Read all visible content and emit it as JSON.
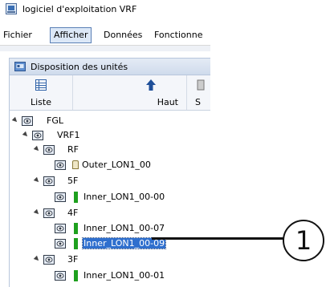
{
  "window": {
    "title": "logiciel d'exploitation VRF"
  },
  "menu": {
    "items": [
      {
        "label": "Fichier"
      },
      {
        "label": "Afficher",
        "active": true
      },
      {
        "label": "Données"
      },
      {
        "label": "Fonctionne"
      }
    ]
  },
  "panel": {
    "title": "Disposition des unités",
    "toolbar": [
      {
        "label": "Liste",
        "icon": "list-icon"
      },
      {
        "label": "Haut",
        "icon": "arrow-up-icon"
      },
      {
        "label": "S",
        "icon": "unknown-icon"
      }
    ]
  },
  "tree": [
    {
      "label": "FGL",
      "type": "group",
      "expanded": true
    },
    {
      "label": "VRF1",
      "type": "group",
      "expanded": true
    },
    {
      "label": "RF",
      "type": "group",
      "expanded": true
    },
    {
      "label": "Outer_LON1_00",
      "type": "outer"
    },
    {
      "label": "5F",
      "type": "group",
      "expanded": true
    },
    {
      "label": "Inner_LON1_00-00",
      "type": "inner"
    },
    {
      "label": "4F",
      "type": "group",
      "expanded": true
    },
    {
      "label": "Inner_LON1_00-07",
      "type": "inner"
    },
    {
      "label": "Inner_LON1_00-09",
      "type": "inner",
      "selected": true
    },
    {
      "label": "3F",
      "type": "group",
      "expanded": true
    },
    {
      "label": "Inner_LON1_00-01",
      "type": "inner"
    }
  ],
  "callout": {
    "number": "1"
  },
  "colors": {
    "selection": "#2f6fce",
    "inner_unit": "#1ea01e",
    "panel_header": "#d6e0ef"
  }
}
